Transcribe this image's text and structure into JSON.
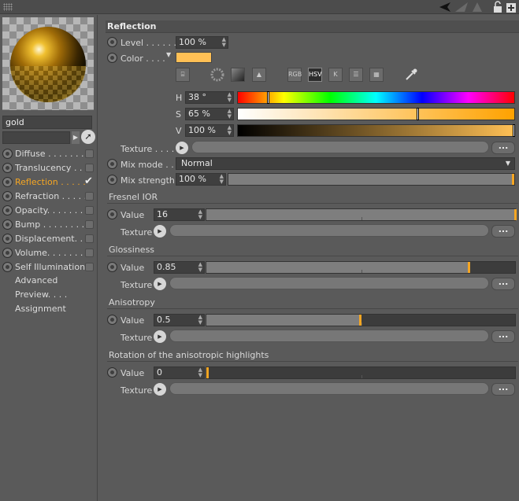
{
  "left": {
    "material_name": "gold",
    "channels": [
      {
        "label": "Diffuse . . . . . . . .",
        "checked": false,
        "active": false
      },
      {
        "label": "Translucency . . .",
        "checked": false,
        "active": false
      },
      {
        "label": "Reflection . . . . .",
        "checked": true,
        "active": true
      },
      {
        "label": "Refraction . . . . .",
        "checked": false,
        "active": false
      },
      {
        "label": "Opacity. . . . . . . .",
        "checked": false,
        "active": false
      },
      {
        "label": "Bump . . . . . . . . .",
        "checked": false,
        "active": false
      },
      {
        "label": "Displacement. . .",
        "checked": false,
        "active": false
      },
      {
        "label": "Volume. . . . . . . .",
        "checked": false,
        "active": false
      },
      {
        "label": "Self Illumination",
        "checked": false,
        "active": false
      }
    ],
    "extras": [
      "Advanced",
      "Preview. . . .",
      "Assignment"
    ]
  },
  "reflection": {
    "title": "Reflection",
    "level_label": "Level . . . . . . .",
    "level_value": "100 %",
    "color_label": "Color . . . .",
    "color_hex": "#ffc055",
    "color_modes": [
      "RGB",
      "HSV",
      "K"
    ],
    "h_label": "H",
    "h_value": "38 °",
    "h_fraction": 0.106,
    "s_label": "S",
    "s_value": "65 %",
    "s_fraction": 0.65,
    "v_label": "V",
    "v_value": "100 %",
    "v_fraction": 1.0,
    "texture_label": "Texture . . . . .",
    "texture_dots": "...",
    "mixmode_label": "Mix mode . . .",
    "mixmode_value": "Normal",
    "mixstrength_label": "Mix strength",
    "mixstrength_value": "100 %",
    "mixstrength_fraction": 1.0
  },
  "groups": [
    {
      "title": "Fresnel IOR",
      "value_label": "Value",
      "value": "16",
      "fraction": 1.0,
      "texture_label": "Texture",
      "dots": "..."
    },
    {
      "title": "Glossiness",
      "value_label": "Value",
      "value": "0.85",
      "fraction": 0.85,
      "texture_label": "Texture",
      "dots": "..."
    },
    {
      "title": "Anisotropy",
      "value_label": "Value",
      "value": "0.5",
      "fraction": 0.5,
      "texture_label": "Texture",
      "dots": "..."
    },
    {
      "title": "Rotation of the anisotropic highlights",
      "value_label": "Value",
      "value": "0",
      "fraction": 0.0,
      "texture_label": "Texture",
      "dots": "..."
    }
  ],
  "colors": {
    "accent": "#f5a623"
  }
}
